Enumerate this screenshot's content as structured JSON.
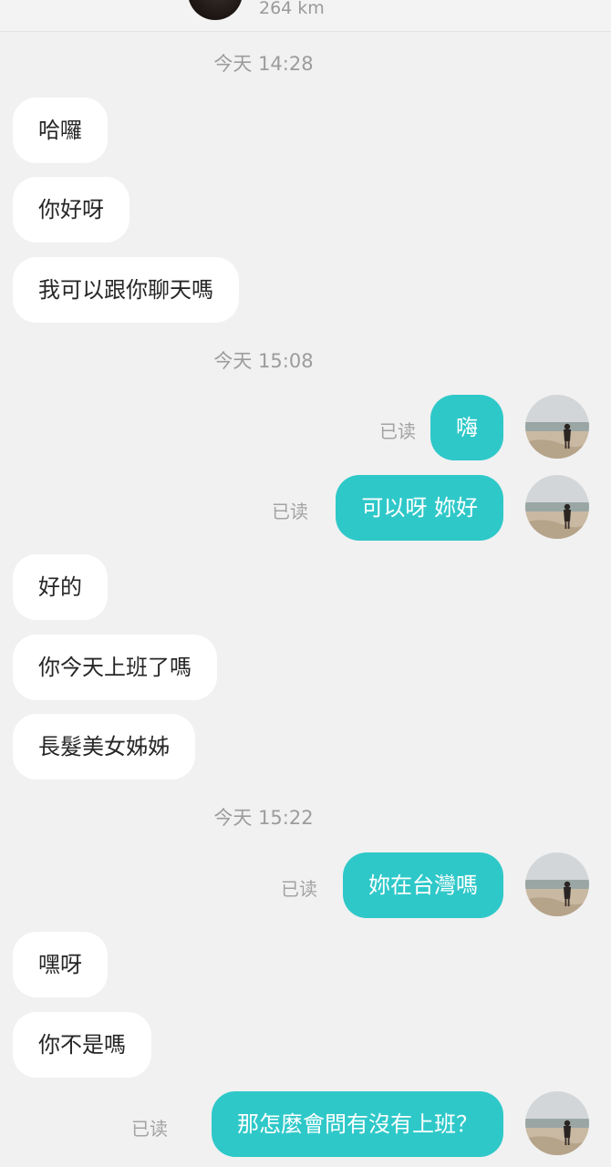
{
  "header": {
    "distance": "264 km"
  },
  "timestamps": [
    "今天 14:28",
    "今天 15:08",
    "今天 15:22"
  ],
  "messages": [
    {
      "dir": "in",
      "text": "哈囉"
    },
    {
      "dir": "in",
      "text": "你好呀"
    },
    {
      "dir": "in",
      "text": "我可以跟你聊天嗎"
    },
    {
      "dir": "out",
      "text": "嗨",
      "status": "已读"
    },
    {
      "dir": "out",
      "text": "可以呀 妳好",
      "status": "已读"
    },
    {
      "dir": "in",
      "text": "好的"
    },
    {
      "dir": "in",
      "text": "你今天上班了嗎"
    },
    {
      "dir": "in",
      "text": "長髮美女姊姊"
    },
    {
      "dir": "out",
      "text": "妳在台灣嗎",
      "status": "已读"
    },
    {
      "dir": "in",
      "text": "嘿呀"
    },
    {
      "dir": "in",
      "text": "你不是嗎"
    },
    {
      "dir": "out",
      "text": "那怎麼會問有沒有上班？",
      "status": "已读"
    }
  ],
  "colors": {
    "background": "#f1f1f1",
    "incoming_bubble": "#ffffff",
    "outgoing_bubble": "#2fc8c9",
    "timestamp_text": "#9c9c9c",
    "read_text": "#a3a3a3"
  },
  "icons": {
    "contact_avatar": "contact-avatar-icon",
    "my_avatar": "beach-photo-avatar-icon"
  }
}
